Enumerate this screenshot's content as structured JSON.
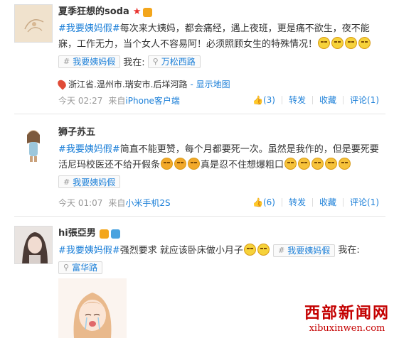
{
  "posts": [
    {
      "username": "夏季狂想的soda",
      "text_a_tag": "#我要姨妈假#",
      "text_a": "每次来大姨妈，都会痛经，遇上夜班，更是痛不欲生，夜不能寐，工作无力，当个女人不容易阿！必须照顾女生的特殊情况！",
      "chip_tag": "我要姨妈假",
      "at_label": "我在:",
      "chip_place": "万松西路",
      "location": "浙江省.温州市.瑞安市.后垟河路",
      "map_link": "- 显示地图",
      "time": "今天 02:27",
      "source_prefix": "来自",
      "source": "iPhone客户端",
      "likes": "(3)",
      "repost": "转发",
      "favorite": "收藏",
      "comment": "评论(1)"
    },
    {
      "username": "狮子苏五",
      "text_a_tag": "#我要姨妈假#",
      "text_a": "简直不能更赞，每个月都要死一次。虽然是我作的，但是要死要活尼玛校医还不给开假条",
      "text_b": "真是忍不住想爆粗口",
      "chip_tag": "我要姨妈假",
      "time": "今天 01:07",
      "source_prefix": "来自",
      "source": "小米手机2S",
      "likes": "(6)",
      "repost": "转发",
      "favorite": "收藏",
      "comment": "评论(1)"
    },
    {
      "username": "hi張亞男",
      "text_a_tag": "#我要姨妈假#",
      "text_a": "强烈要求 就应该卧床做小月子",
      "chip_tag": "我要姨妈假",
      "at_label": "我在:",
      "chip_place": "富华路"
    }
  ],
  "watermark": {
    "title": "西部新闻网",
    "url": "xibuxinwen.com"
  },
  "colors": {
    "link": "#1b7fd8",
    "watermark": "#c40000"
  }
}
